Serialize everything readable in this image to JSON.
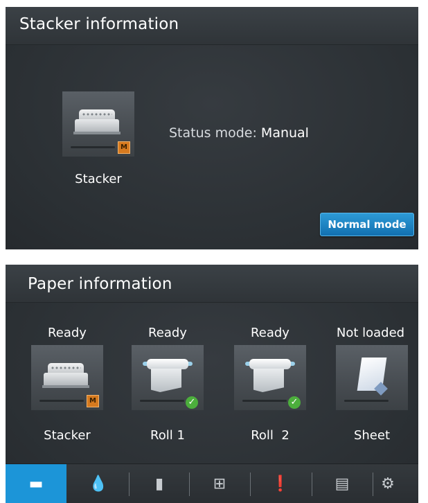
{
  "stacker_panel": {
    "title": "Stacker information",
    "device_label": "Stacker",
    "badge": "M",
    "status_label": "Status mode:",
    "status_value": "Manual",
    "normal_mode_button": "Normal mode"
  },
  "paper_panel": {
    "title": "Paper information",
    "items": [
      {
        "status": "Ready",
        "label": "Stacker",
        "badge": "M",
        "icon": "stacker-icon"
      },
      {
        "status": "Ready",
        "label": "Roll 1",
        "icon": "roll-icon",
        "check": "✓"
      },
      {
        "status": "Ready",
        "label": "Roll  2",
        "icon": "roll-icon",
        "check": "✓"
      },
      {
        "status": "Not loaded",
        "label": "Sheet",
        "icon": "sheet-icon"
      }
    ]
  },
  "nav": {
    "items": [
      {
        "name": "paper-nav",
        "glyph": "▬",
        "active": true
      },
      {
        "name": "ink-nav",
        "glyph": "💧"
      },
      {
        "name": "printhead-nav",
        "glyph": "▮"
      },
      {
        "name": "network-nav",
        "glyph": "⊞"
      },
      {
        "name": "alerts-nav",
        "glyph": "❗"
      },
      {
        "name": "printer-nav",
        "glyph": "▤"
      },
      {
        "name": "settings-nav",
        "glyph": "⚙"
      }
    ]
  },
  "colors": {
    "accent": "#1c95d8",
    "manual_badge": "#d67a1f",
    "ready_check": "#4cae3c"
  }
}
